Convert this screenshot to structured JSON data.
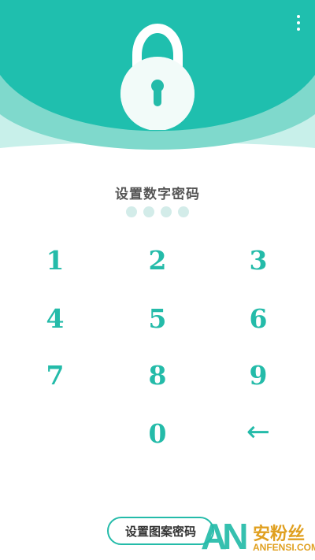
{
  "colors": {
    "accent": "#24bba9",
    "header_dark": "#1fbfae",
    "header_light": "#7fd9cc",
    "header_pale": "#c8f0ea",
    "dot_empty": "#d3ece9",
    "watermark_orange": "#e0a020"
  },
  "header": {
    "menu_icon": "more-vertical-icon",
    "lock_icon": "padlock-icon"
  },
  "title": "设置数字密码",
  "pin_length": 4,
  "pin_entered": 0,
  "keypad": {
    "keys": [
      "1",
      "2",
      "3",
      "4",
      "5",
      "6",
      "7",
      "8",
      "9",
      "0"
    ],
    "backspace": "←"
  },
  "pattern_button": "设置图案密码",
  "watermark": {
    "logo": "AN",
    "name": "安粉丝",
    "domain": "ANFENSI.COM"
  }
}
